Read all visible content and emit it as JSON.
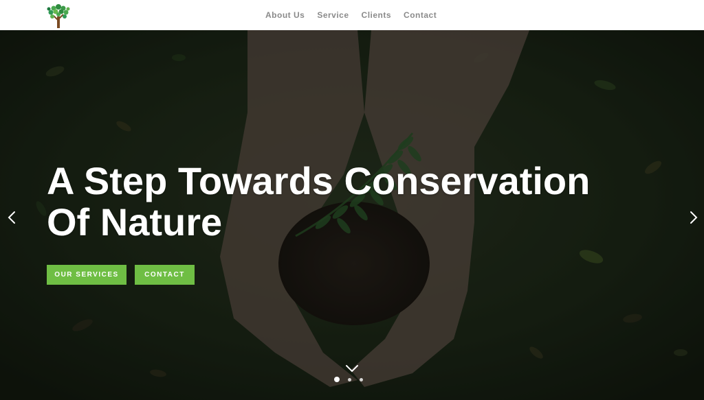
{
  "header": {
    "logo_icon": "tree-logo-icon",
    "nav": [
      {
        "label": "About Us"
      },
      {
        "label": "Service"
      },
      {
        "label": "Clients"
      },
      {
        "label": "Contact"
      }
    ]
  },
  "hero": {
    "title_line1": "A Step Towards Conservation",
    "title_line2": "Of Nature",
    "buttons": {
      "services_label": "OUR SERVICES",
      "contact_label": "CONTACT"
    },
    "prev_icon": "chevron-left-icon",
    "next_icon": "chevron-right-icon",
    "scroll_icon": "chevron-down-icon",
    "slides_count": 3,
    "active_slide": 1
  },
  "colors": {
    "accent": "#6fbe44",
    "nav_text": "#8a8a8a",
    "title": "#ffffff"
  }
}
